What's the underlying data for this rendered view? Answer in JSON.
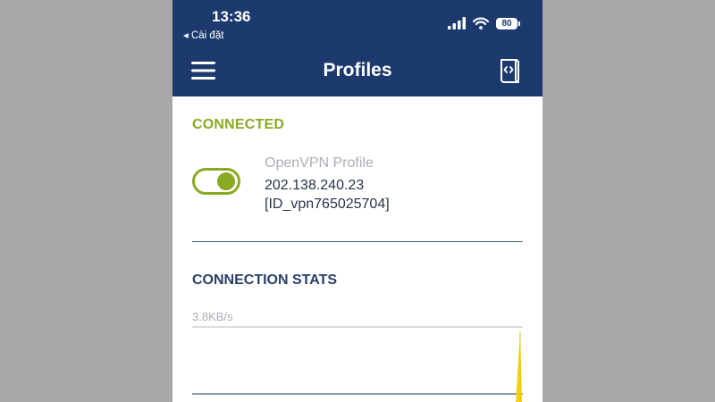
{
  "status_bar": {
    "time": "13:36",
    "back_label": "◂ Cài đặt",
    "battery": "80"
  },
  "header": {
    "title": "Profiles"
  },
  "connected_section": {
    "heading": "CONNECTED",
    "toggle_on": true,
    "profile_name": "OpenVPN Profile",
    "ip_address": "202.138.240.23",
    "profile_id": "[ID_vpn765025704]"
  },
  "stats_section": {
    "heading": "CONNECTION STATS",
    "speed_label": "3.8KB/s"
  },
  "colors": {
    "header_bg": "#1d3a6e",
    "accent_green": "#8aaa22",
    "stats_heading": "#2a4068",
    "chart_spike": "#f2d31b"
  },
  "icons": [
    "menu-icon",
    "document-code-icon",
    "signal-icon",
    "wifi-icon",
    "battery-icon"
  ]
}
